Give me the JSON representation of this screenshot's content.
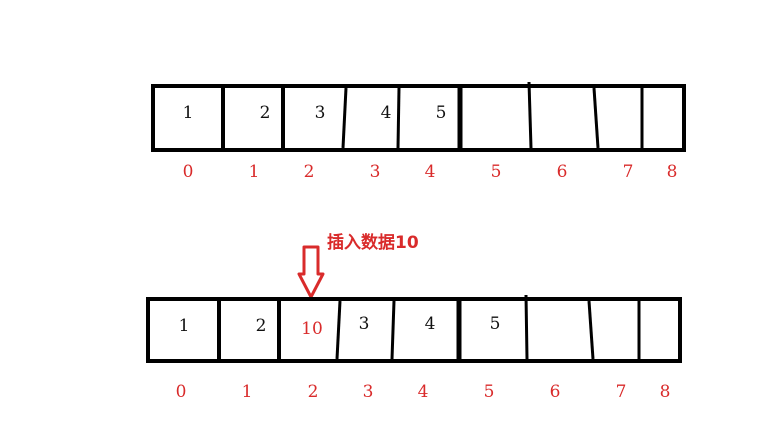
{
  "arrays": [
    {
      "cells": [
        "1",
        "2",
        "3",
        "4",
        "5",
        "",
        "",
        "",
        ""
      ],
      "indices": [
        "0",
        "1",
        "2",
        "3",
        "4",
        "5",
        "6",
        "7",
        "8"
      ]
    },
    {
      "cells": [
        "1",
        "2",
        "10",
        "3",
        "4",
        "5",
        "",
        "",
        ""
      ],
      "indices": [
        "0",
        "1",
        "2",
        "3",
        "4",
        "5",
        "6",
        "7",
        "8"
      ]
    }
  ],
  "insert_note": "插入数据10",
  "inserted_value": "10",
  "colors": {
    "outline": "#000000",
    "accent": "#d92b2b",
    "text": "#111111"
  }
}
